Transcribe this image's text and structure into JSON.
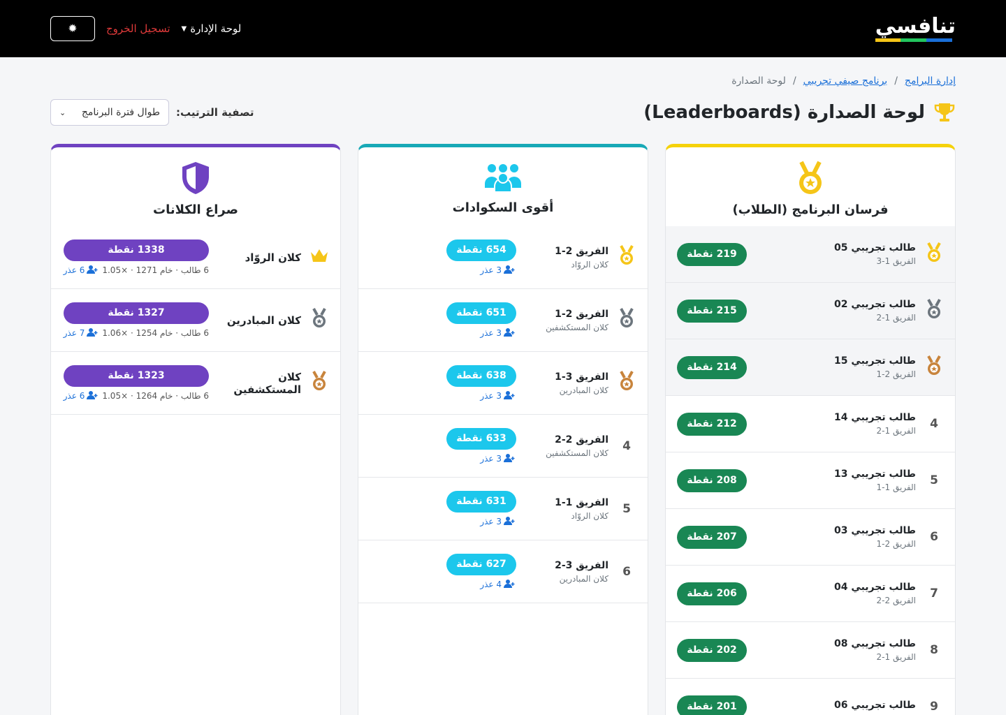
{
  "nav": {
    "logo_text": "تنافسي",
    "logo_colors": [
      "#1a6fd8",
      "#22c55e",
      "#f5c518"
    ],
    "admin_menu": "لوحة الإدارة",
    "logout": "تسجيل الخروج",
    "theme_icon": "gear-icon"
  },
  "breadcrumb": [
    "إدارة البرامج",
    "برنامج صيفي تجريبي",
    "لوحة الصدارة"
  ],
  "page_title": "لوحة الصدارة (Leaderboards)",
  "filter": {
    "label": "تصفية الترتيب:",
    "value": "طوال فترة البرنامج"
  },
  "students": {
    "title": "فرسان البرنامج (الطلاب)",
    "accent": "#f5d20b",
    "rows": [
      {
        "rank": "1",
        "name": "طالب تجريبي 05",
        "team": "الفريق 1-3",
        "points": "219 نقطة"
      },
      {
        "rank": "2",
        "name": "طالب تجريبي 02",
        "team": "الفريق 1-2",
        "points": "215 نقطة"
      },
      {
        "rank": "3",
        "name": "طالب تجريبي 15",
        "team": "الفريق 2-1",
        "points": "214 نقطة"
      },
      {
        "rank": "4",
        "name": "طالب تجريبي 14",
        "team": "الفريق 1-2",
        "points": "212 نقطة"
      },
      {
        "rank": "5",
        "name": "طالب تجريبي 13",
        "team": "الفريق 1-1",
        "points": "208 نقطة"
      },
      {
        "rank": "6",
        "name": "طالب تجريبي 03",
        "team": "الفريق 2-1",
        "points": "207 نقطة"
      },
      {
        "rank": "7",
        "name": "طالب تجريبي 04",
        "team": "الفريق 2-2",
        "points": "206 نقطة"
      },
      {
        "rank": "8",
        "name": "طالب تجريبي 08",
        "team": "الفريق 1-2",
        "points": "202 نقطة"
      },
      {
        "rank": "9",
        "name": "طالب تجريبي 06",
        "team": "",
        "points": "201 نقطة"
      }
    ]
  },
  "squads": {
    "title": "أقوى السكوادات",
    "accent": "#18a9b7",
    "rows": [
      {
        "rank": "1",
        "name": "الفريق 2-1",
        "clan": "كلان الروّاد",
        "points": "654 نقطة",
        "members": "3 عذر"
      },
      {
        "rank": "2",
        "name": "الفريق 2-1",
        "clan": "كلان المستكشفين",
        "points": "651 نقطة",
        "members": "3 عذر"
      },
      {
        "rank": "3",
        "name": "الفريق 3-1",
        "clan": "كلان المبادرين",
        "points": "638 نقطة",
        "members": "3 عذر"
      },
      {
        "rank": "4",
        "name": "الفريق 2-2",
        "clan": "كلان المستكشفين",
        "points": "633 نقطة",
        "members": "3 عذر"
      },
      {
        "rank": "5",
        "name": "الفريق 1-1",
        "clan": "كلان الروّاد",
        "points": "631 نقطة",
        "members": "3 عذر"
      },
      {
        "rank": "6",
        "name": "الفريق 3-2",
        "clan": "كلان المبادرين",
        "points": "627 نقطة",
        "members": "4 عذر"
      }
    ]
  },
  "clans": {
    "title": "صراع الكلانات",
    "accent": "#6f42c1",
    "rows": [
      {
        "rank": "1",
        "name": "كلان الروّاد",
        "points": "1338 نقطة",
        "meta": "6 طالب · خام 1271 · ×1.05",
        "members": "6 عذر"
      },
      {
        "rank": "2",
        "name": "كلان المبادرين",
        "points": "1327 نقطة",
        "meta": "6 طالب · خام 1254 · ×1.06",
        "members": "7 عذر"
      },
      {
        "rank": "3",
        "name": "كلان المستكشفين",
        "points": "1323 نقطة",
        "meta": "6 طالب · خام 1264 · ×1.05",
        "members": "6 عذر"
      }
    ]
  },
  "medal_colors": {
    "gold": "#f5c518",
    "silver": "#6c757d",
    "bronze": "#c8843c",
    "crown": "#f5c518"
  }
}
